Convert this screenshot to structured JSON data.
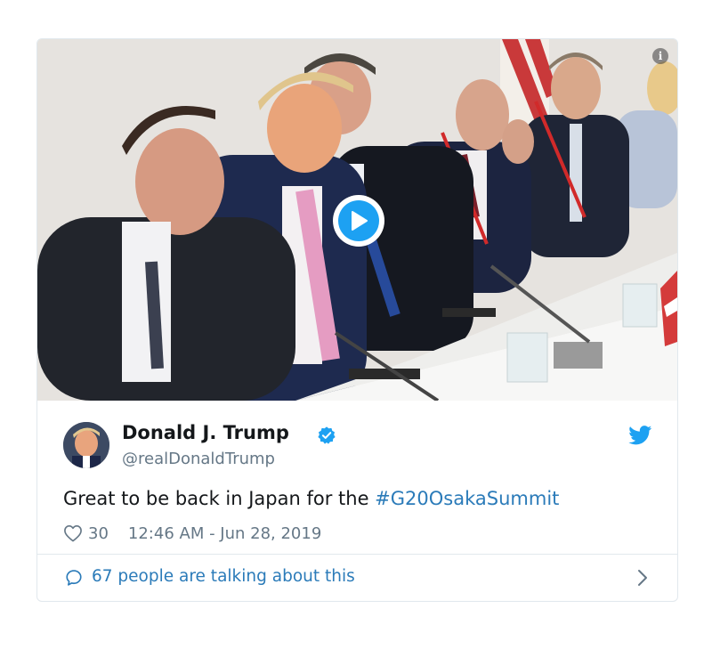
{
  "media": {
    "info_glyph": "i",
    "play_icon": "play-icon"
  },
  "author": {
    "display_name": "Donald J. Trump",
    "handle": "@realDonaldTrump",
    "verified": true
  },
  "tweet": {
    "text": "Great to be back in Japan for the ",
    "hashtag": "#G20OsakaSummit",
    "like_count": "30",
    "timestamp": "12:46 AM - Jun 28, 2019"
  },
  "footer": {
    "talking_label": "67 people are talking about this"
  },
  "colors": {
    "accent": "#1da1f2",
    "link": "#2b7bb9",
    "muted": "#657786",
    "border": "#e1e8ed"
  }
}
